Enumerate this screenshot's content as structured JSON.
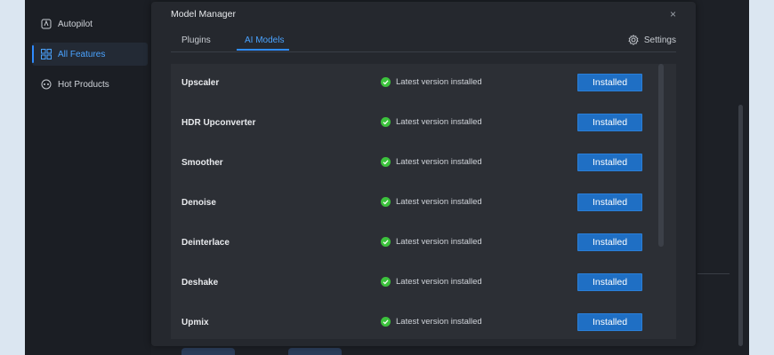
{
  "sidebar": {
    "items": [
      {
        "label": "Autopilot",
        "icon": "autopilot-icon"
      },
      {
        "label": "All Features",
        "icon": "grid-icon",
        "active": true
      },
      {
        "label": "Hot Products",
        "icon": "hot-products-icon"
      }
    ]
  },
  "dialog": {
    "title": "Model Manager",
    "close": "×",
    "tabs": [
      {
        "label": "Plugins"
      },
      {
        "label": "AI Models",
        "active": true
      }
    ],
    "settings_label": "Settings"
  },
  "models": [
    {
      "name": "Upscaler",
      "status": "Latest version installed",
      "button": "Installed"
    },
    {
      "name": "HDR Upconverter",
      "status": "Latest version installed",
      "button": "Installed"
    },
    {
      "name": "Smoother",
      "status": "Latest version installed",
      "button": "Installed"
    },
    {
      "name": "Denoise",
      "status": "Latest version installed",
      "button": "Installed"
    },
    {
      "name": "Deinterlace",
      "status": "Latest version installed",
      "button": "Installed"
    },
    {
      "name": "Deshake",
      "status": "Latest version installed",
      "button": "Installed"
    },
    {
      "name": "Upmix",
      "status": "Latest version installed",
      "button": "Installed"
    }
  ],
  "colors": {
    "accent": "#2f8cff",
    "button": "#1f6fc4",
    "success": "#3cc23c"
  }
}
